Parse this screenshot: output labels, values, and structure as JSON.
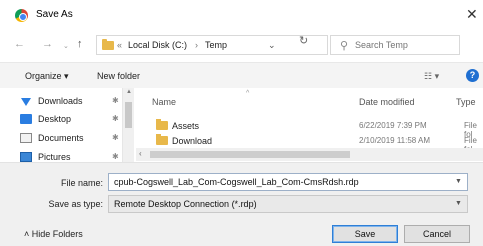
{
  "window": {
    "title": "Save As",
    "close_glyph": "✕"
  },
  "nav": {
    "back_glyph": "←",
    "forward_glyph": "→",
    "recent_glyph": "⌄",
    "up_glyph": "↑",
    "breadcrumb_prefix": "«",
    "breadcrumb": [
      "Local Disk (C:)",
      "Temp"
    ],
    "separator": "›",
    "dropdown_glyph": "⌄",
    "refresh_glyph": "↻"
  },
  "search": {
    "icon_glyph": "⚲",
    "placeholder": "Search Temp"
  },
  "toolbar": {
    "organize_label": "Organize ▾",
    "new_folder_label": "New folder",
    "view_glyph": "☷ ▾",
    "help_glyph": "?"
  },
  "sidebar": {
    "items": [
      {
        "label": "Downloads",
        "icon": "download-icon",
        "pin": "✱"
      },
      {
        "label": "Desktop",
        "icon": "desktop-icon",
        "pin": "✱"
      },
      {
        "label": "Documents",
        "icon": "documents-icon",
        "pin": "✱"
      },
      {
        "label": "Pictures",
        "icon": "pictures-icon",
        "pin": "✱"
      }
    ],
    "scroll_up_glyph": "▲"
  },
  "file_list": {
    "columns": {
      "name": "Name",
      "date": "Date modified",
      "type": "Type"
    },
    "sort_glyph": "^",
    "rows": [
      {
        "name": "Assets",
        "date": "6/22/2019 7:39 PM",
        "type": "File fol"
      },
      {
        "name": "Download",
        "date": "2/10/2019 11:58 AM",
        "type": "File fol"
      }
    ],
    "hscroll_left_glyph": "‹"
  },
  "form": {
    "file_name_label": "File name:",
    "file_name_value": "cpub-Cogswell_Lab_Com-Cogswell_Lab_Com-CmsRdsh.rdp",
    "save_type_label": "Save as type:",
    "save_type_value": "Remote Desktop Connection (*.rdp)",
    "dropdown_glyph": "▼"
  },
  "footer": {
    "hide_folders_label": "˄  Hide Folders",
    "save_label": "Save",
    "cancel_label": "Cancel"
  },
  "colors": {
    "accent": "#2f7fd6",
    "folder": "#e8b84a",
    "help": "#1f6fd1"
  }
}
